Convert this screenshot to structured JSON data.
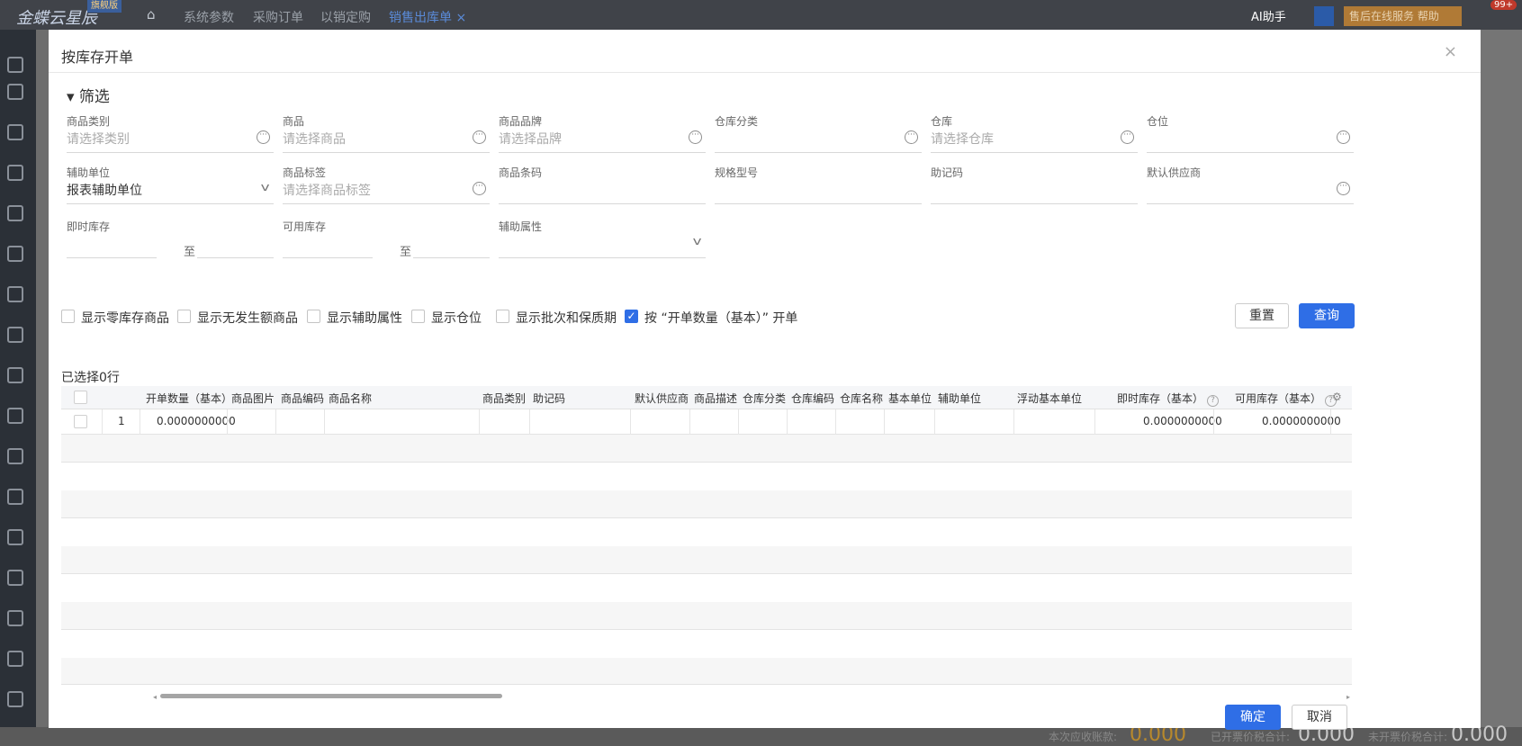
{
  "topbar": {
    "logo": "金蝶云星辰",
    "logo_tag": "旗舰版",
    "tabs": [
      "系统参数",
      "采购订单",
      "以销定购",
      "销售出库单 ×"
    ],
    "ai_label": "AI助手",
    "service_label": "售后在线服务  帮助",
    "notif_badge": "99+"
  },
  "bottombar": {
    "receivable_label": "本次应收账款:",
    "receivable_value": "0.000",
    "invoiced_label": "已开票价税合计:",
    "invoiced_value": "0.000",
    "uninvoiced_label": "未开票价税合计:",
    "uninvoiced_value": "0.000"
  },
  "modal": {
    "title": "按库存开单",
    "close": "×",
    "filter_title": "▾ 筛选",
    "fields": {
      "category": {
        "label": "商品类别",
        "placeholder": "请选择类别"
      },
      "product": {
        "label": "商品",
        "placeholder": "请选择商品"
      },
      "brand": {
        "label": "商品品牌",
        "placeholder": "请选择品牌"
      },
      "wh_category": {
        "label": "仓库分类",
        "placeholder": ""
      },
      "warehouse": {
        "label": "仓库",
        "placeholder": "请选择仓库"
      },
      "location": {
        "label": "仓位",
        "placeholder": ""
      },
      "aux_unit": {
        "label": "辅助单位",
        "value": "报表辅助单位"
      },
      "tag": {
        "label": "商品标签",
        "placeholder": "请选择商品标签"
      },
      "barcode": {
        "label": "商品条码",
        "placeholder": ""
      },
      "spec": {
        "label": "规格型号",
        "placeholder": ""
      },
      "mnemonic": {
        "label": "助记码",
        "placeholder": ""
      },
      "supplier": {
        "label": "默认供应商",
        "placeholder": ""
      },
      "stock_now": {
        "label": "即时库存",
        "to": "至"
      },
      "stock_avail": {
        "label": "可用库存",
        "to": "至"
      },
      "aux_attr": {
        "label": "辅助属性",
        "placeholder": ""
      }
    },
    "checks": [
      {
        "label": "显示零库存商品",
        "checked": false
      },
      {
        "label": "显示无发生额商品",
        "checked": false
      },
      {
        "label": "显示辅助属性",
        "checked": false
      },
      {
        "label": "显示仓位",
        "checked": false
      },
      {
        "label": "显示批次和保质期",
        "checked": false
      },
      {
        "label": "按 “开单数量（基本）” 开单",
        "checked": true
      }
    ],
    "reset_label": "重置",
    "query_label": "查询",
    "selected_text": "已选择0行",
    "columns": [
      "开单数量（基本）",
      "商品图片",
      "商品编码",
      "商品名称",
      "商品类别",
      "助记码",
      "默认供应商",
      "商品描述",
      "仓库分类",
      "仓库编码",
      "仓库名称",
      "基本单位",
      "辅助单位",
      "浮动基本单位",
      "即时库存（基本）",
      "可用库存（基本）"
    ],
    "rows": [
      {
        "index": "1",
        "qty": "0.0000000000",
        "stock_now": "0.0000000000",
        "stock_avail": "0.0000000000"
      }
    ],
    "confirm_label": "确定",
    "cancel_label": "取消"
  }
}
